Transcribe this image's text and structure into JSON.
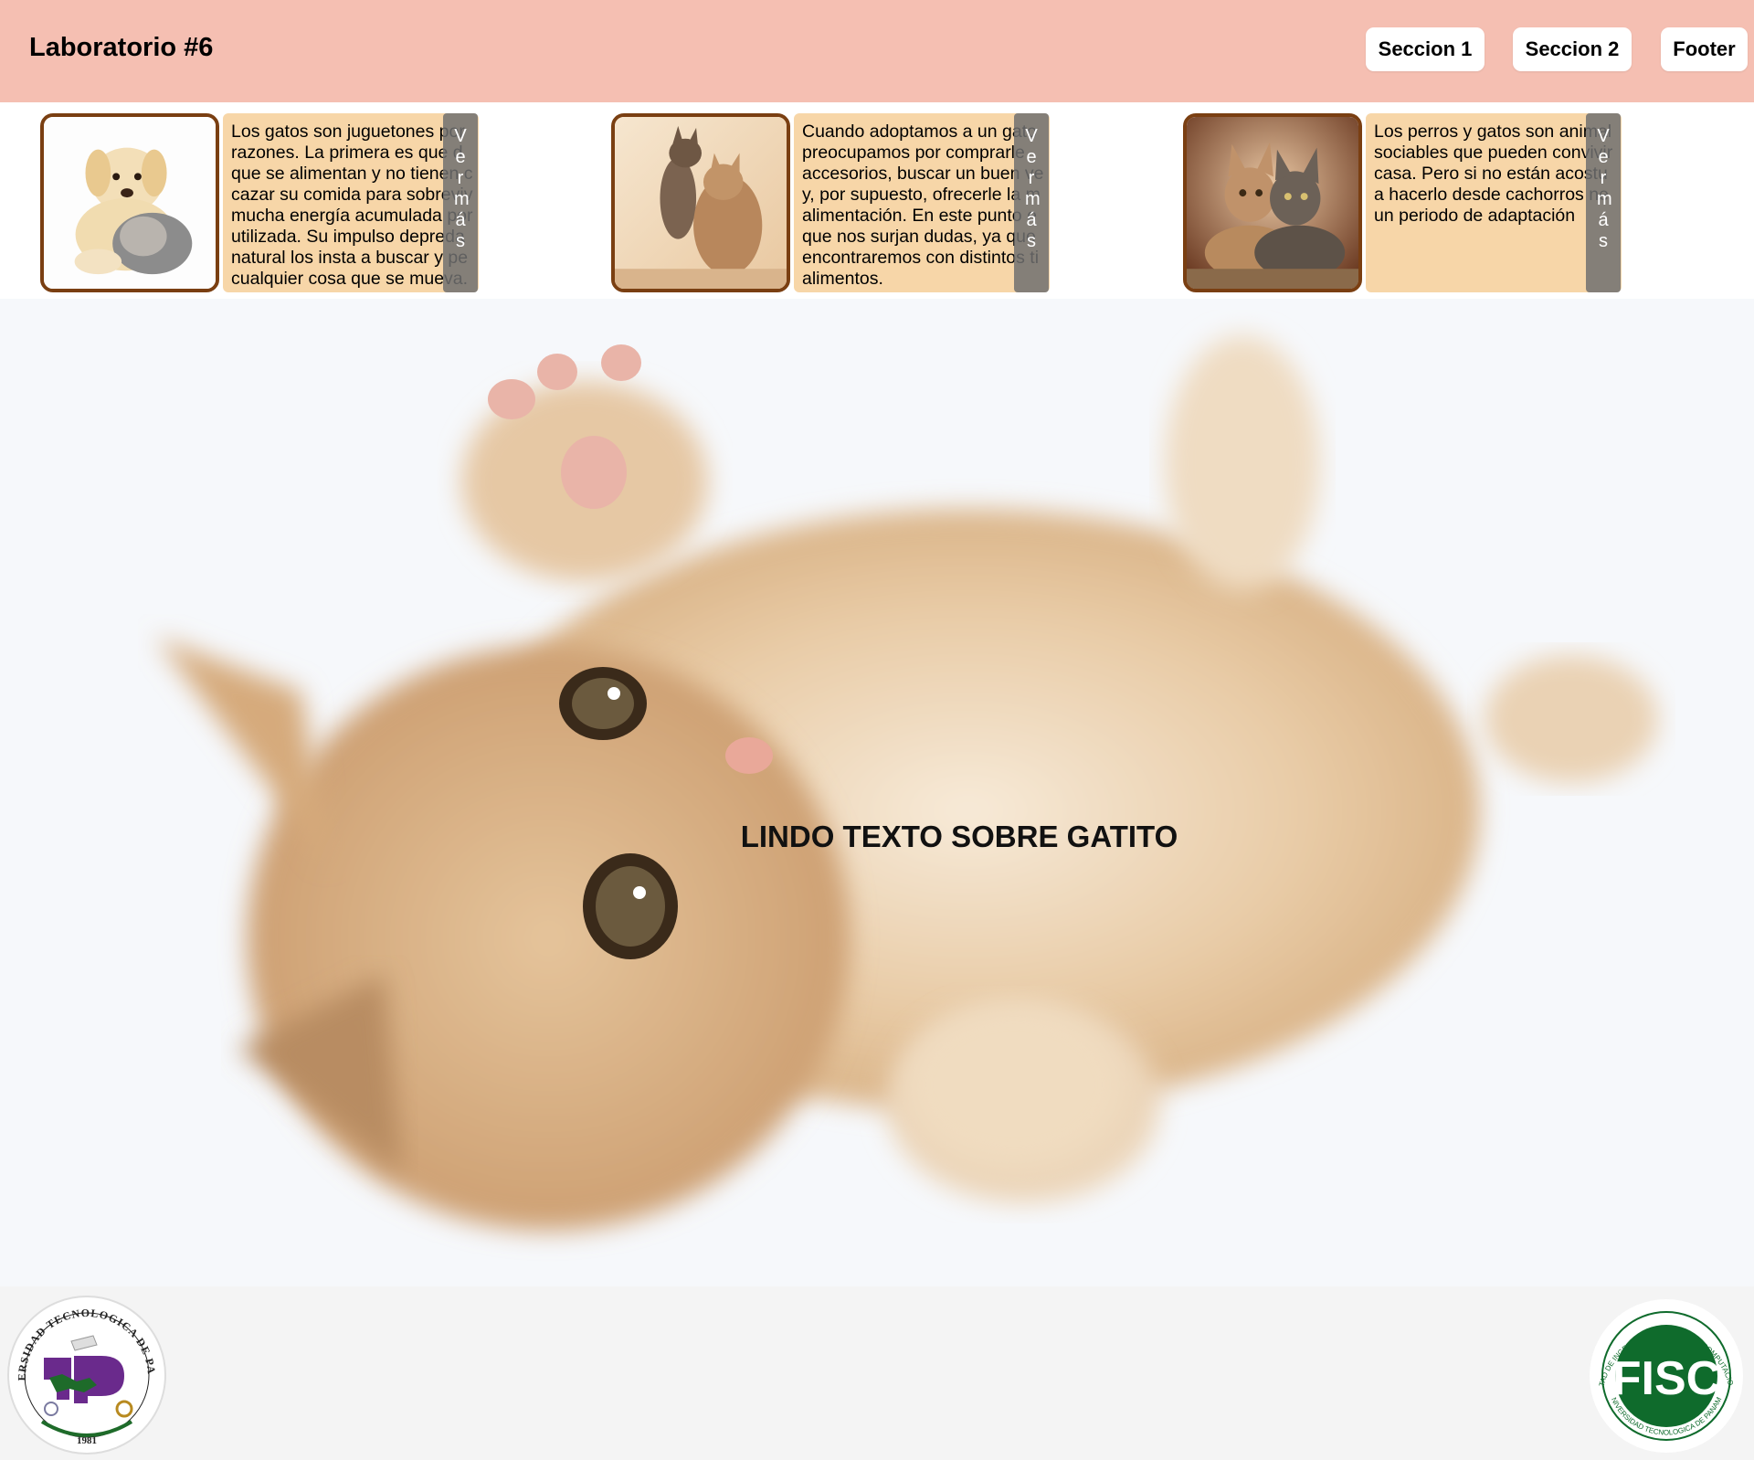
{
  "header": {
    "title": "Laboratorio #6",
    "nav": [
      {
        "label": "Seccion 1"
      },
      {
        "label": "Seccion 2"
      },
      {
        "label": "Footer"
      }
    ]
  },
  "cards": [
    {
      "image": "puppy-and-kitten-photo",
      "text": "Los gatos son juguetones por\nrazones. La primera es que d\nque se alimentan y no tienen c\ncazar su comida para sobreviv\nmucha energía acumulada por\nutilizada. Su impulso depreda\nnatural los insta a buscar y pe\ncualquier cosa que se mueva.",
      "button": "Ver más"
    },
    {
      "image": "two-kittens-playing-photo",
      "text": "Cuando adoptamos a un gato\npreocupamos por comprarle\naccesorios, buscar un buen ve\ny, por supuesto, ofrecerle la m\nalimentación. En este punto e\nque nos surjan dudas, ya que\nencontraremos con distintos ti\nalimentos.",
      "button": "Ver más"
    },
    {
      "image": "two-cats-lying-photo",
      "text": "Los perros y gatos son animal\nsociables que pueden convivir\ncasa. Pero si no están acostu\na hacerlo desde cachorros ne\nun periodo de adaptación",
      "button": "Ver más"
    }
  ],
  "hero": {
    "image": "kitten-on-back-photo",
    "text": "LINDO TEXTO SOBRE GATITO"
  },
  "footer": {
    "left_logo": "utp-university-logo",
    "right_logo": "fisc-faculty-logo",
    "utp_ring_text": "UNIVERSIDAD TECNOLOGICA DE PANAMA",
    "utp_year": "1981",
    "fisc_ring_text": "FACULTAD DE INGENIERIA DE SISTEMAS COMPUTACIONALES",
    "fisc_ring_text_bottom": "UNIVERSIDAD TECNOLOGICA DE PANAMA",
    "fisc_mark": "FISC",
    "utp_mark": "UTP"
  },
  "colors": {
    "header_bg": "#f5bfb2",
    "card_text_bg": "#f7d6a8",
    "card_border": "#7a3f12",
    "vermas_bg": "#707070",
    "footer_bg": "#f4f4f4",
    "utp_purple": "#6a2a8c",
    "fisc_green": "#0f6b2c"
  }
}
